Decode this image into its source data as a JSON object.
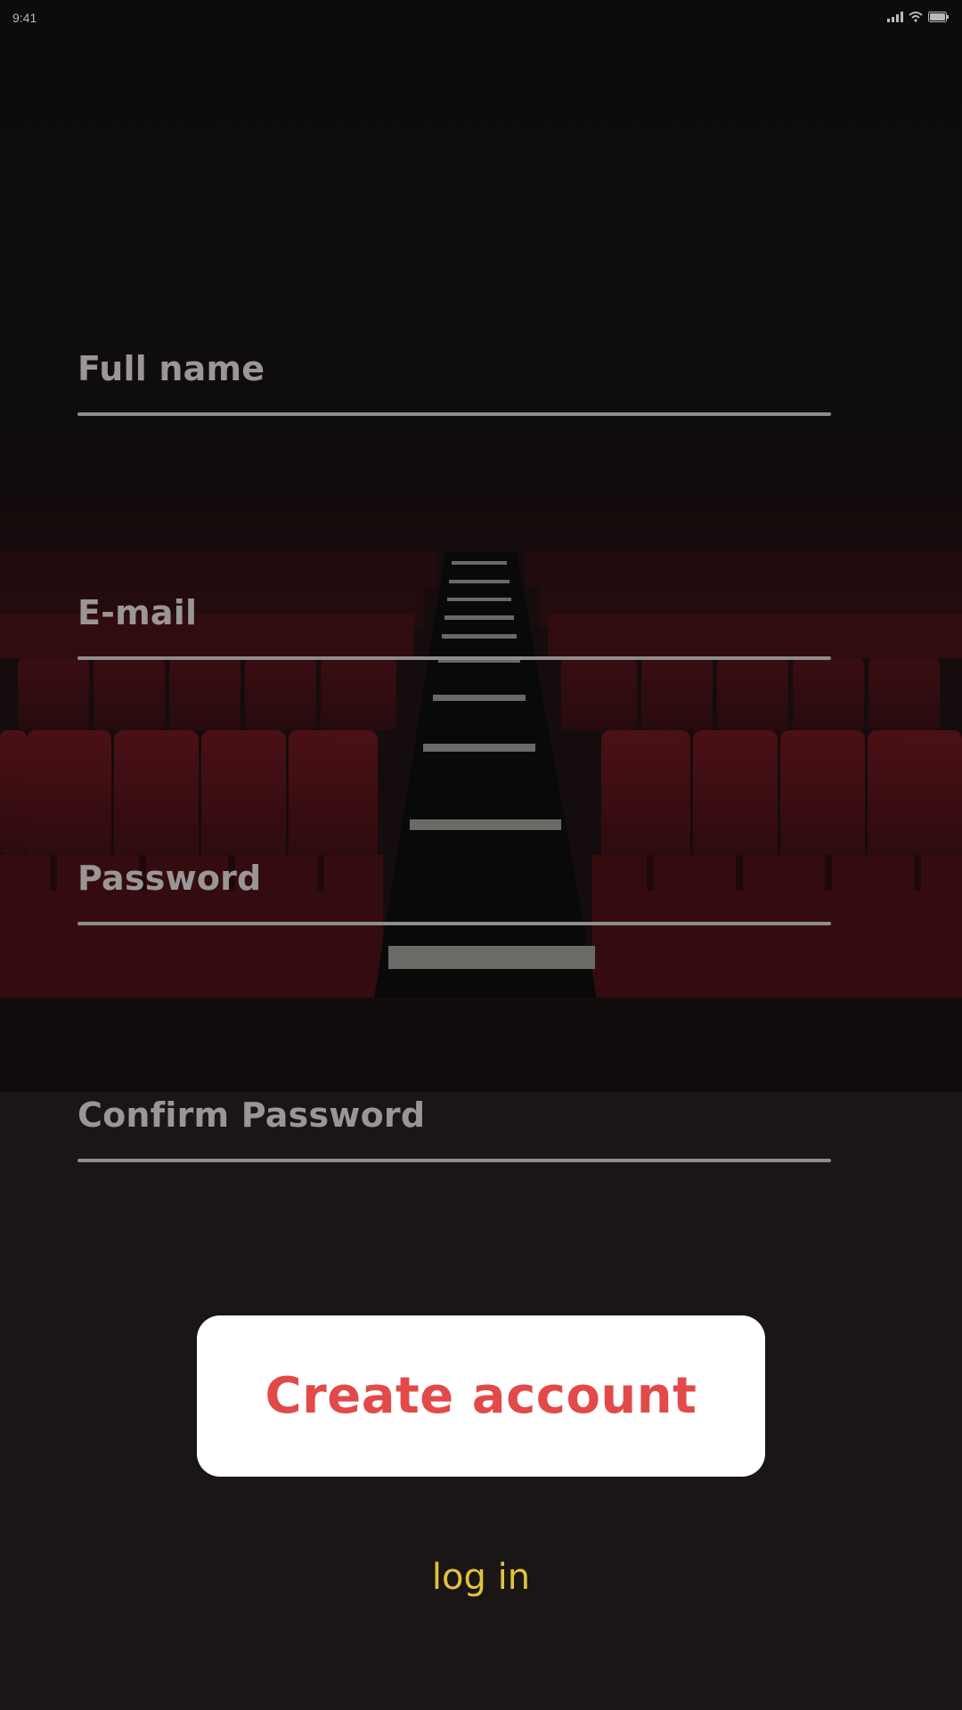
{
  "status_bar": {
    "time": "9:41",
    "icons": [
      "signal-icon",
      "wifi-icon",
      "battery-icon"
    ]
  },
  "form": {
    "full_name": {
      "placeholder": "Full name"
    },
    "email": {
      "placeholder": "E-mail"
    },
    "password": {
      "placeholder": "Password"
    },
    "confirm_password": {
      "placeholder": "Confirm Password"
    }
  },
  "actions": {
    "create_account_label": "Create account",
    "login_label": "log in"
  },
  "colors": {
    "background": "#1a1616",
    "field_label": "#9a9696",
    "field_underline": "#8f8c8c",
    "button_bg": "#ffffff",
    "button_text": "#e24a4a",
    "login_link": "#e2c23e",
    "seat_red": "#6b1218"
  },
  "background_image": "theater-seats-aisle"
}
